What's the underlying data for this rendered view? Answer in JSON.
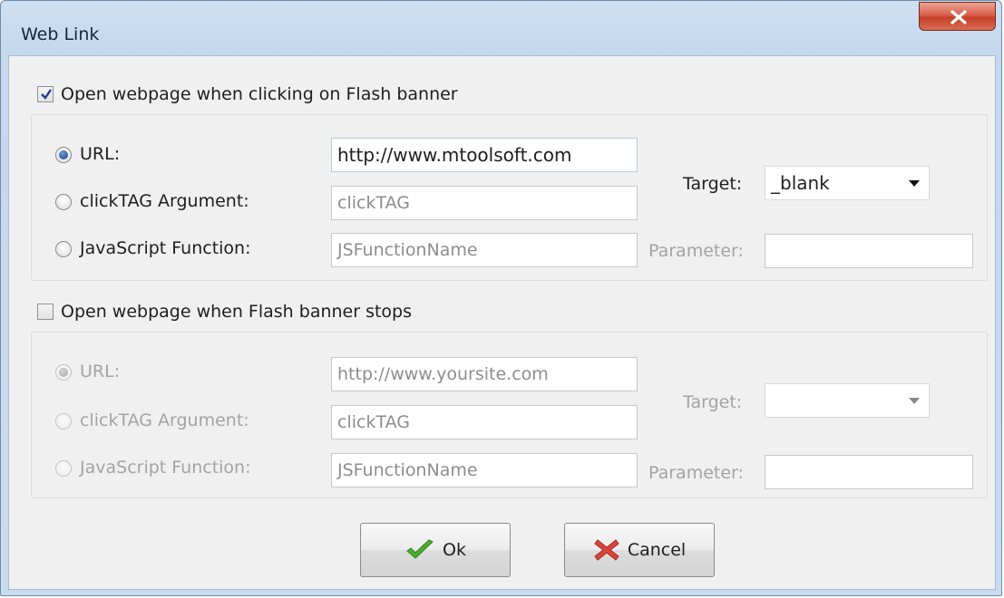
{
  "window": {
    "title": "Web Link",
    "close_glyph": "X"
  },
  "section1": {
    "checkbox_label": "Open webpage when clicking on Flash banner",
    "checked": true,
    "url_label": "URL:",
    "url_value": "http://www.mtoolsoft.com",
    "clicktag_label": "clickTAG Argument:",
    "clicktag_placeholder": "clickTAG",
    "js_label": "JavaScript Function:",
    "js_placeholder": "JSFunctionName",
    "target_label": "Target:",
    "target_value": "_blank",
    "parameter_label": "Parameter:",
    "parameter_value": "",
    "selected_option": "URL"
  },
  "section2": {
    "checkbox_label": "Open webpage when Flash banner stops",
    "checked": false,
    "url_label": "URL:",
    "url_placeholder": "http://www.yoursite.com",
    "clicktag_label": "clickTAG Argument:",
    "clicktag_value": "clickTAG",
    "js_label": "JavaScript Function:",
    "js_value": "JSFunctionName",
    "target_label": "Target:",
    "target_value": "",
    "parameter_label": "Parameter:",
    "parameter_value": "",
    "selected_option": "URL"
  },
  "buttons": {
    "ok_label": "Ok",
    "cancel_label": "Cancel"
  },
  "icons": {
    "ok": "checkmark-icon",
    "cancel": "cross-icon",
    "close": "close-icon"
  },
  "colors": {
    "titlebar": "#c9dcef",
    "close": "#c7402a",
    "ok_icon": "#4caf2a",
    "cancel_icon": "#d9453a"
  }
}
